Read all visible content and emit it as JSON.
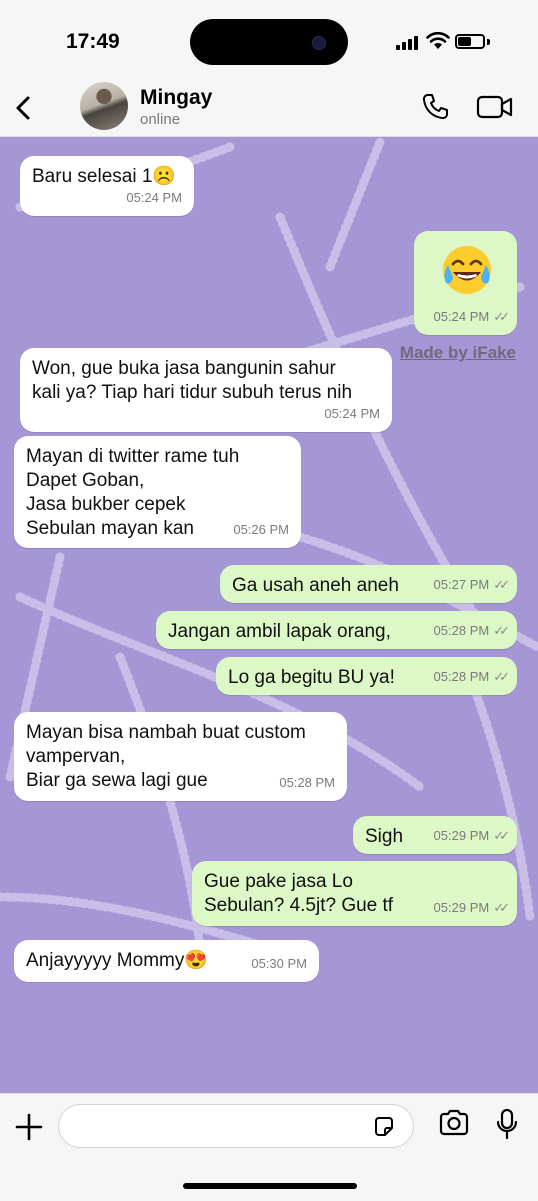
{
  "status_bar": {
    "time": "17:49",
    "battery_level": 0.55
  },
  "header": {
    "contact_name": "Mingay",
    "contact_status": "online"
  },
  "messages": [
    {
      "dir": "in",
      "text": "Baru selesai 1☹️",
      "time": "05:24 PM",
      "read": false
    },
    {
      "dir": "out",
      "emoji": "face-with-tears-of-joy",
      "text": "",
      "time": "05:24 PM",
      "read": true
    },
    {
      "dir": "in",
      "text": "Won, gue buka jasa bangunin sahur\nkali ya? Tiap hari tidur subuh terus nih",
      "time": "05:24 PM",
      "read": false
    },
    {
      "dir": "in",
      "text": "Mayan di twitter rame tuh\nDapet Goban,\nJasa bukber cepek\nSebulan mayan kan",
      "time": "05:26 PM",
      "read": false
    },
    {
      "dir": "out",
      "text": "Ga usah aneh aneh",
      "time": "05:27 PM",
      "read": true
    },
    {
      "dir": "out",
      "text": "Jangan ambil lapak orang,",
      "time": "05:28 PM",
      "read": true
    },
    {
      "dir": "out",
      "text": "Lo ga begitu BU ya!",
      "time": "05:28 PM",
      "read": true
    },
    {
      "dir": "in",
      "text": "Mayan bisa nambah buat custom\nvampervan,\nBiar ga sewa lagi gue",
      "time": "05:28 PM",
      "read": false
    },
    {
      "dir": "out",
      "text": "Sigh",
      "time": "05:29 PM",
      "read": true
    },
    {
      "dir": "out",
      "text": "Gue pake jasa Lo\nSebulan? 4.5jt? Gue tf",
      "time": "05:29 PM",
      "read": true
    },
    {
      "dir": "in",
      "text": "Anjayyyyy Mommy😍",
      "time": "05:30 PM",
      "read": false
    }
  ],
  "watermark": "Made by iFake",
  "input": {
    "placeholder": ""
  },
  "colors": {
    "chat_bg": "#a596d6",
    "incoming": "#ffffff",
    "outgoing": "#dbf8c6"
  },
  "icons": [
    "back-icon",
    "phone-icon",
    "video-icon",
    "plus-icon",
    "sticker-icon",
    "camera-icon",
    "mic-icon"
  ]
}
